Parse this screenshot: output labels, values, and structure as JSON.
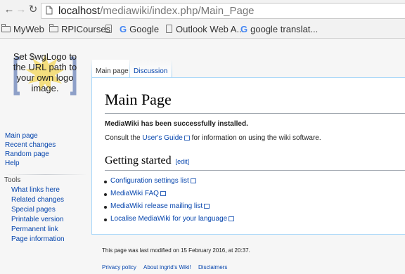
{
  "browser": {
    "url_host": "localhost",
    "url_path": "/mediawiki/index.php/Main_Page",
    "bookmarks": [
      {
        "icon": "folder-icon",
        "label": "MyWeb"
      },
      {
        "icon": "folder-icon",
        "label": "RPICourses"
      },
      {
        "icon": "page-icon",
        "label": ""
      },
      {
        "icon": "google-icon",
        "label": "Google"
      },
      {
        "icon": "page-icon",
        "label": "Outlook Web A..."
      },
      {
        "icon": "google-icon",
        "label": "google translat..."
      }
    ]
  },
  "logo": {
    "text": "Set $wgLogo to the URL path to your own logo image."
  },
  "sidebar": {
    "nav": [
      "Main page",
      "Recent changes",
      "Random page",
      "Help"
    ],
    "tools_heading": "Tools",
    "tools": [
      "What links here",
      "Related changes",
      "Special pages",
      "Printable version",
      "Permanent link",
      "Page information"
    ]
  },
  "tabs": [
    "Main page",
    "Discussion"
  ],
  "content": {
    "title": "Main Page",
    "installed": "MediaWiki has been successfully installed.",
    "consult_prefix": "Consult the ",
    "consult_link": "User's Guide",
    "consult_suffix": " for information on using the wiki software.",
    "getting_started": "Getting started",
    "edit": "[edit]",
    "list": [
      "Configuration settings list",
      "MediaWiki FAQ",
      "MediaWiki release mailing list",
      "Localise MediaWiki for your language"
    ]
  },
  "footer": {
    "modified": "This page was last modified on 15 February 2016, at 20:37.",
    "links": [
      "Privacy policy",
      "About ingrid's Wiki!",
      "Disclaimers"
    ]
  }
}
